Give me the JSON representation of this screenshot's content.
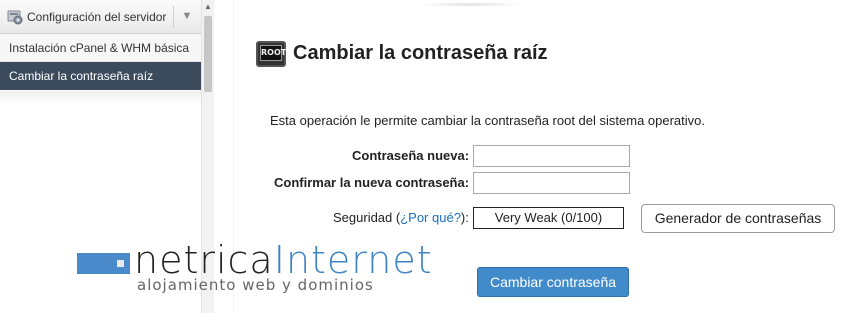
{
  "sidebar": {
    "header_title": "Configuración del servidor",
    "items": [
      {
        "label": "Instalación cPanel & WHM básica",
        "active": false
      },
      {
        "label": "Cambiar la contraseña raíz",
        "active": true
      }
    ]
  },
  "page": {
    "icon_text": "ROOT",
    "title": "Cambiar la contraseña raíz",
    "description": "Esta operación le permite cambiar la contraseña root del sistema operativo."
  },
  "form": {
    "new_password_label": "Contraseña nueva:",
    "new_password_value": "",
    "confirm_password_label": "Confirmar la nueva contraseña:",
    "confirm_password_value": "",
    "security_prefix": "Seguridad (",
    "security_why_link": "¿Por qué?",
    "security_suffix": "):",
    "strength_value": "Very Weak (0/100)",
    "generator_button": "Generador de contraseñas",
    "submit_button": "Cambiar contraseña"
  },
  "watermark": {
    "brand_part1": "netrica",
    "brand_part2": "Internet",
    "tagline": "alojamiento web y dominios"
  },
  "colors": {
    "sidebar_active_bg": "#3b4b5c",
    "primary_button": "#428bca",
    "link": "#1a6fc0",
    "logo_accent": "#3f84c7"
  }
}
